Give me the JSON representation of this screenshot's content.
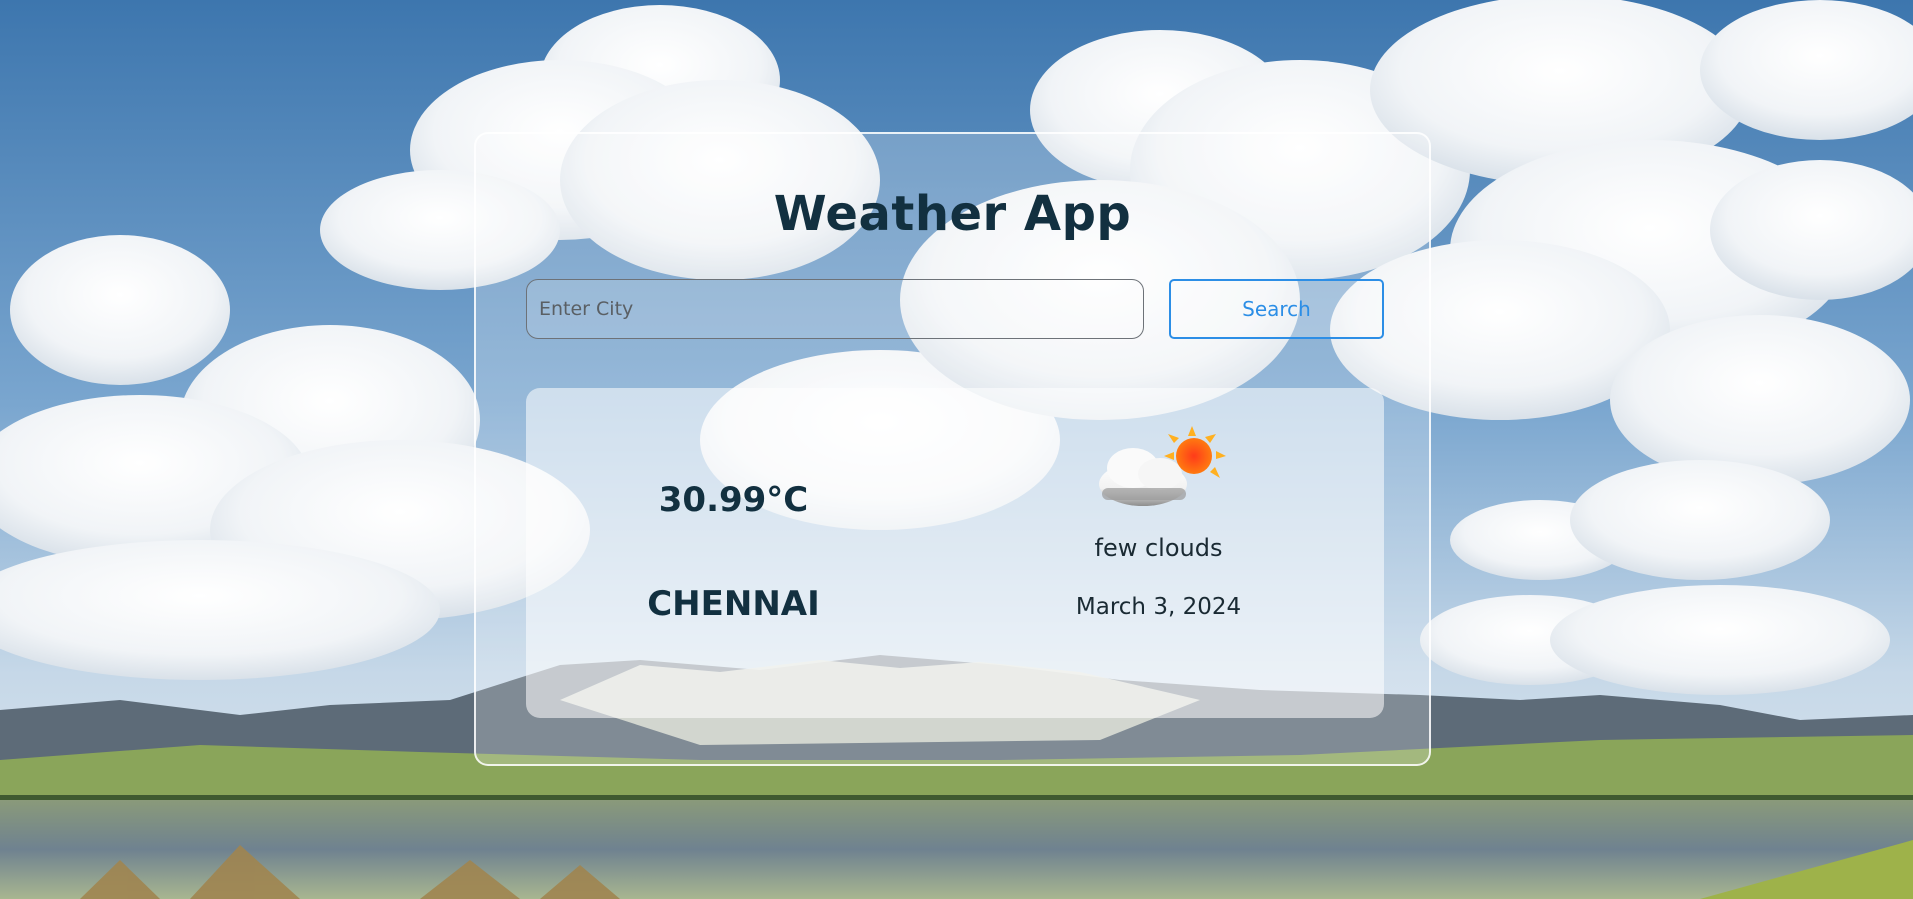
{
  "app": {
    "title": "Weather App"
  },
  "search": {
    "placeholder": "Enter City",
    "value": "",
    "button_label": "Search"
  },
  "weather": {
    "temperature": "30.99°C",
    "city": "CHENNAI",
    "description": "few clouds",
    "date": "March 3, 2024",
    "icon": "few-clouds-day-icon"
  },
  "colors": {
    "title_text": "#123040",
    "search_accent": "#2c8ee6",
    "sky_top": "#3f78b0",
    "sun": "#ff5a14"
  }
}
